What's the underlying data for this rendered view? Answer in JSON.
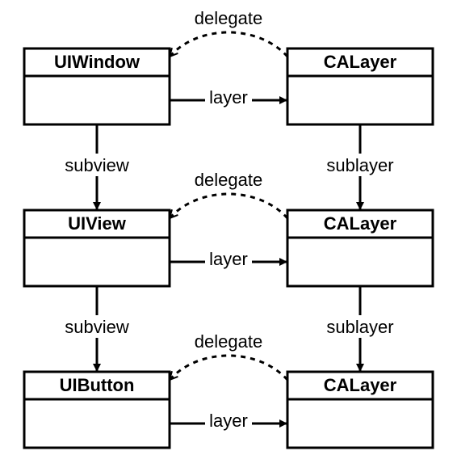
{
  "nodes": {
    "left": [
      "UIWindow",
      "UIView",
      "UIButton"
    ],
    "right": [
      "CALayer",
      "CALayer",
      "CALayer"
    ]
  },
  "edges": {
    "layer": "layer",
    "delegate": "delegate",
    "subview": "subview",
    "sublayer": "sublayer"
  }
}
